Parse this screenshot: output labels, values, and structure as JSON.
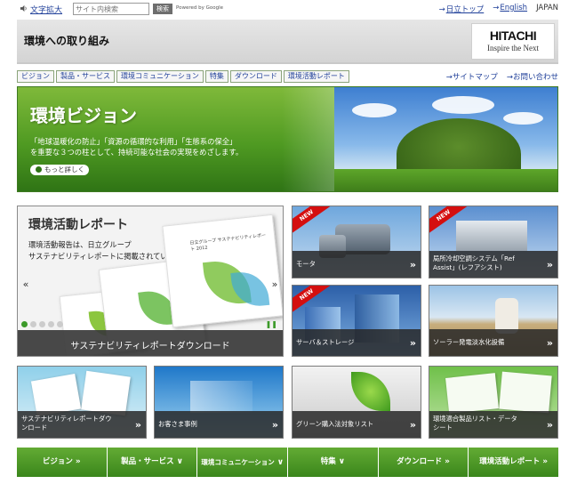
{
  "topbar": {
    "font_size_label": "文字拡大",
    "search_placeholder": "サイト内検索",
    "search_button": "検索",
    "powered": "Powered by Google",
    "links": [
      {
        "label": "日立トップ"
      },
      {
        "label": "English"
      }
    ],
    "region": "JAPAN"
  },
  "header": {
    "title": "環境への取り組み",
    "logo_main": "HITACHI",
    "logo_sub": "Inspire the Next"
  },
  "nav": {
    "tabs": [
      {
        "label": "ビジョン"
      },
      {
        "label": "製品・サービス"
      },
      {
        "label": "環境コミュニケーション"
      },
      {
        "label": "特集"
      },
      {
        "label": "ダウンロード"
      },
      {
        "label": "環境活動レポート"
      }
    ],
    "right_links": [
      {
        "label": "サイトマップ"
      },
      {
        "label": "お問い合わせ"
      }
    ]
  },
  "hero": {
    "title": "環境ビジョン",
    "line1": "「地球温暖化の防止」「資源の循環的な利用」「生態系の保全」",
    "line2": "を重要な３つの柱として、持続可能な社会の実現をめざします。",
    "button": "もっと詳しく"
  },
  "report": {
    "title": "環境活動レポート",
    "line1": "環境活動報告は、日立グループ",
    "line2": "サステナビリティレポートに掲載されています。",
    "book_title": "日立グループ サステナビリティレポート 2012",
    "prev": "«",
    "next": "»",
    "bar_label": "サステナビリティレポートダウンロード"
  },
  "tiles": {
    "new_badge": "NEW",
    "chevron": "»",
    "items": [
      {
        "line1": "モータ",
        "line2": ""
      },
      {
        "line1": "局所冷却空調システム「Ref",
        "line2": "Assist」(レフアシスト)"
      },
      {
        "line1": "サーバ＆ストレージ",
        "line2": ""
      },
      {
        "line1": "ソーラー発電淡水化設備",
        "line2": ""
      },
      {
        "line1": "サステナビリティレポートダウ",
        "line2": "ンロード"
      },
      {
        "line1": "お客さま事例",
        "line2": ""
      },
      {
        "line1": "グリーン購入法対象リスト",
        "line2": ""
      },
      {
        "line1": "環境適合製品リスト・データ",
        "line2": "シート"
      }
    ]
  },
  "bottom_nav": {
    "items": [
      {
        "label": "ビジョン",
        "chev": "»"
      },
      {
        "label": "製品・サービス",
        "chev": "∨"
      },
      {
        "label": "環境コミュニケーション",
        "chev": "∨"
      },
      {
        "label": "特集",
        "chev": "∨"
      },
      {
        "label": "ダウンロード",
        "chev": "»"
      },
      {
        "label": "環境活動レポート",
        "chev": "»"
      }
    ]
  },
  "colors": {
    "brand_green": "#3a861b",
    "link_blue": "#1f3f99",
    "new_red": "#d40f0f"
  }
}
